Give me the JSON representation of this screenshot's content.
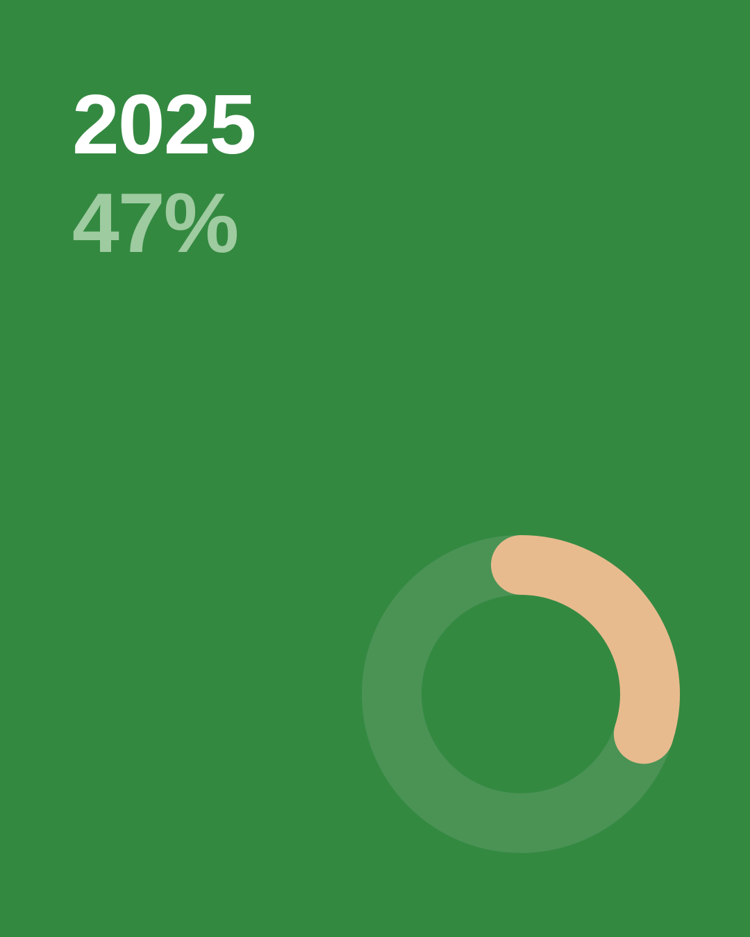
{
  "headline": {
    "year": "2025",
    "percent_label": "47%"
  },
  "colors": {
    "background": "#348941",
    "year_text": "#FFFFFF",
    "percent_text": "#9ECBA0",
    "track": "#4A9355",
    "progress": "#E8BB8E"
  },
  "chart_data": {
    "type": "donut",
    "title": "2025",
    "value_label": "47%",
    "slices": [
      {
        "value": 30,
        "color": "#E8BB8E"
      },
      {
        "value": 70,
        "color": "#4A9355"
      }
    ],
    "direction": "clockwise",
    "start": "top"
  }
}
